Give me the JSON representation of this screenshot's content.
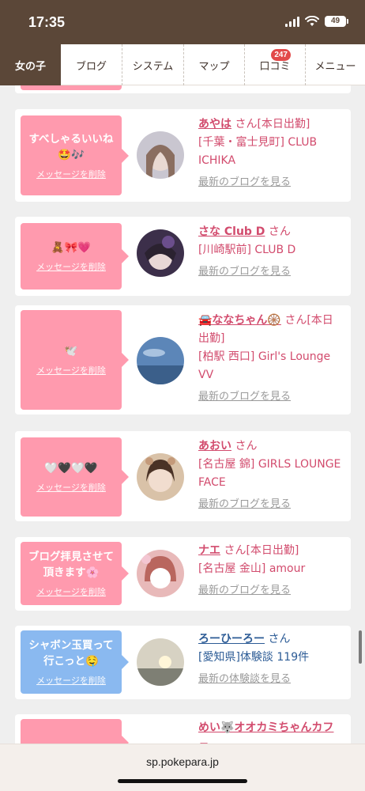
{
  "status": {
    "time": "17:35",
    "battery": "49"
  },
  "nav": {
    "tabs": [
      {
        "label": "女の子"
      },
      {
        "label": "ブログ"
      },
      {
        "label": "システム"
      },
      {
        "label": "マップ"
      },
      {
        "label": "口コミ",
        "badge": "247"
      },
      {
        "label": "メニュー"
      }
    ]
  },
  "delete_label": "メッセージを削除",
  "san": "さん",
  "cards": [
    {
      "message": "すべしゃるいいね🤩🎶",
      "name": "あやは",
      "san_suffix": "[本日出勤]",
      "shop": "[千葉・富士見町] CLUB ICHIKA",
      "link": "最新のブログを見る"
    },
    {
      "message": "🧸🎀💗",
      "name": "さな Club D",
      "san_suffix": "",
      "shop": "[川崎駅前] CLUB D",
      "link": "最新のブログを見る"
    },
    {
      "message": "🕊️",
      "name": "🚘ななちゃん🛞",
      "san_suffix": "[本日出勤]",
      "shop": "[柏駅 西口] Girl's Lounge VV",
      "link": "最新のブログを見る"
    },
    {
      "message": "🤍🖤🤍🖤",
      "name": "あおい",
      "san_suffix": "",
      "shop": "[名古屋 錦] GIRLS LOUNGE FACE",
      "link": "最新のブログを見る"
    },
    {
      "message": "ブログ拝見させて頂きます🌸",
      "name": "ナエ",
      "san_suffix": "[本日出勤]",
      "shop": "[名古屋 金山] amour",
      "link": "最新のブログを見る"
    },
    {
      "message": "シャボン玉買って行こっと🤤",
      "name": "ろーひーろー",
      "san_suffix": "",
      "shop": "[愛知県]体験談 119件",
      "link": "最新の体験談を見る"
    },
    {
      "message": "",
      "name": "めい🐺オオカミちゃんカフェ",
      "san_suffix": "",
      "shop": "",
      "link": ""
    }
  ],
  "url": "sp.pokepara.jp",
  "colors": {
    "header": "#5b4738",
    "pink": "#ff9aae",
    "blue": "#8ab9f0",
    "name_pink": "#d24b6d",
    "name_blue": "#2d5c96"
  }
}
